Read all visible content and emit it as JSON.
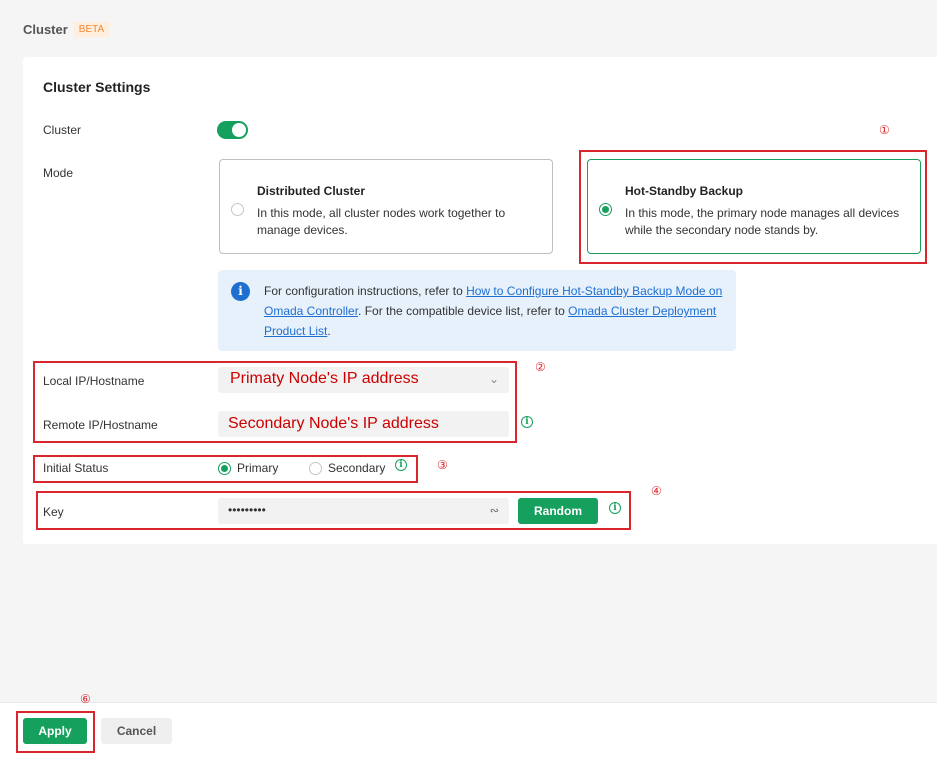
{
  "header": {
    "title": "Cluster",
    "badge": "BETA"
  },
  "settings": {
    "title": "Cluster Settings",
    "cluster_label": "Cluster",
    "cluster_enabled": true,
    "mode_label": "Mode",
    "modes": [
      {
        "name": "Distributed Cluster",
        "description": "In this mode, all cluster nodes work together to manage devices.",
        "selected": false
      },
      {
        "name": "Hot-Standby Backup",
        "description": "In this mode, the primary node manages all devices while the secondary node stands by.",
        "selected": true
      }
    ],
    "info": {
      "text1": "For configuration instructions, refer to ",
      "link1": "How to Configure Hot-Standby Backup Mode on Omada Controller",
      "text2": ". For the compatible device list, refer to ",
      "link2": "Omada Cluster Deployment Product List",
      "text3": "."
    },
    "local_label": "Local IP/Hostname",
    "local_value": "Primaty Node's IP address",
    "remote_label": "Remote IP/Hostname",
    "remote_value": "Secondary Node's IP address",
    "status_label": "Initial Status",
    "status_options": [
      "Primary",
      "Secondary"
    ],
    "status_selected": "Primary",
    "key_label": "Key",
    "key_value": "•••••••••",
    "random_label": "Random"
  },
  "annotations": {
    "color": "#d9262c",
    "markers": [
      "①",
      "②",
      "③",
      "④",
      "⑥"
    ]
  },
  "footer": {
    "apply_label": "Apply",
    "cancel_label": "Cancel"
  },
  "colors": {
    "accent": "#16a05d",
    "link": "#1f6fd1",
    "info_bg": "#e7f1fb"
  }
}
